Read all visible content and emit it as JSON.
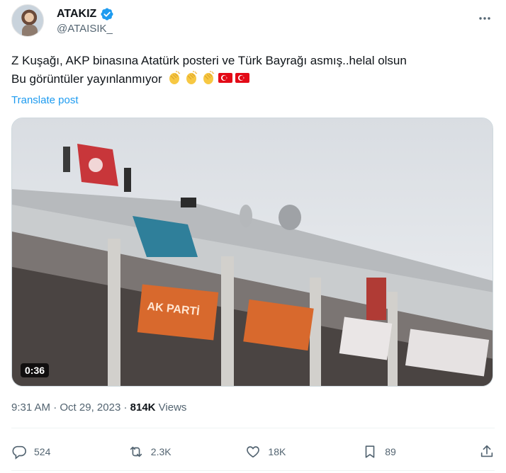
{
  "author": {
    "display_name": "ATAKIZ",
    "handle": "@ATAISIK_",
    "verified": true,
    "verified_color": "#1d9bf0"
  },
  "tweet": {
    "line1": "Z Kuşağı, AKP binasına Atatürk posteri ve Türk Bayrağı asmış..helal olsun",
    "line2": "Bu görüntüler yayınlanmıyor",
    "emojis": [
      "clapping-hands",
      "clapping-hands",
      "clapping-hands",
      "turkish-flag",
      "turkish-flag"
    ],
    "translate_label": "Translate post"
  },
  "media": {
    "type": "video",
    "duration": "0:36",
    "sign_text": "AK PARTİ"
  },
  "meta": {
    "time": "9:31 AM",
    "separator": "·",
    "date": "Oct 29, 2023",
    "views_count": "814K",
    "views_label": "Views"
  },
  "actions": {
    "replies": "524",
    "reposts": "2.3K",
    "likes": "18K",
    "bookmarks": "89"
  },
  "colors": {
    "link": "#1d9bf0",
    "secondary_text": "#536471",
    "primary_text": "#0f1419"
  }
}
